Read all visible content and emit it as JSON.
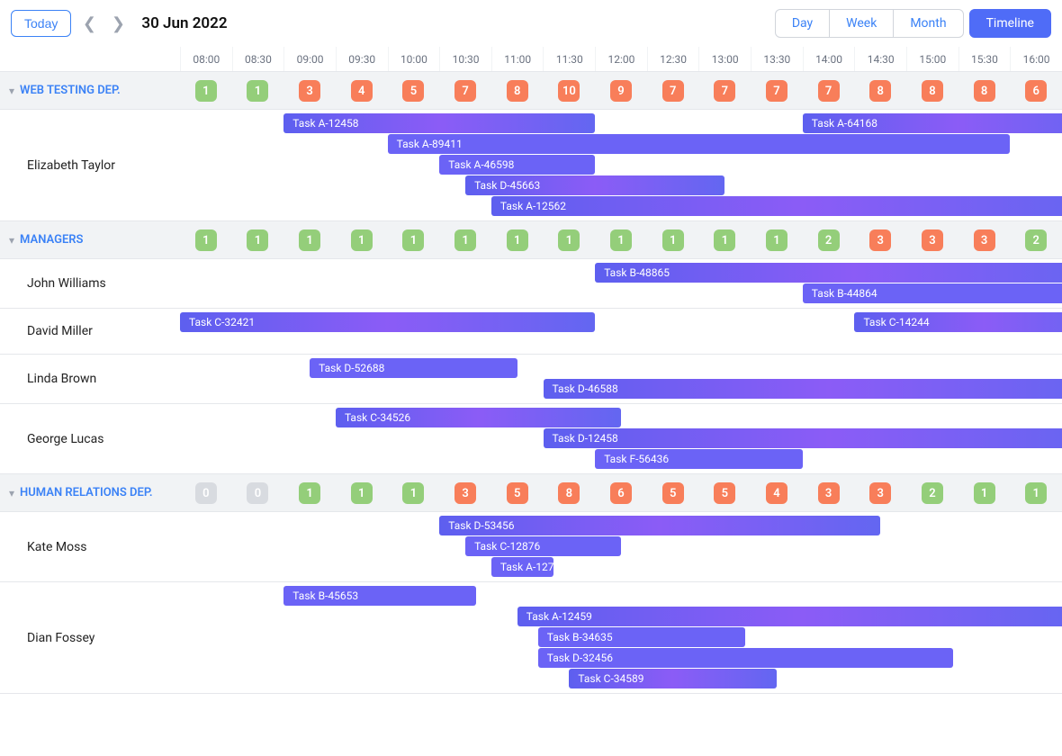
{
  "toolbar": {
    "today": "Today",
    "date": "30 Jun 2022",
    "views": {
      "day": "Day",
      "week": "Week",
      "month": "Month",
      "timeline": "Timeline"
    }
  },
  "timeSlots": [
    "08:00",
    "08:30",
    "09:00",
    "09:30",
    "10:00",
    "10:30",
    "11:00",
    "11:30",
    "12:00",
    "12:30",
    "13:00",
    "13:30",
    "14:00",
    "14:30",
    "15:00",
    "15:30",
    "16:00"
  ],
  "colWidth": 57.65,
  "groups": [
    {
      "name": "WEB TESTING DEP.",
      "badges": [
        {
          "v": "1",
          "c": "green"
        },
        {
          "v": "1",
          "c": "green"
        },
        {
          "v": "3",
          "c": "red"
        },
        {
          "v": "4",
          "c": "red"
        },
        {
          "v": "5",
          "c": "red"
        },
        {
          "v": "7",
          "c": "red"
        },
        {
          "v": "8",
          "c": "red"
        },
        {
          "v": "10",
          "c": "red"
        },
        {
          "v": "9",
          "c": "red"
        },
        {
          "v": "7",
          "c": "red"
        },
        {
          "v": "7",
          "c": "red"
        },
        {
          "v": "7",
          "c": "red"
        },
        {
          "v": "7",
          "c": "red"
        },
        {
          "v": "8",
          "c": "red"
        },
        {
          "v": "8",
          "c": "red"
        },
        {
          "v": "8",
          "c": "red"
        },
        {
          "v": "6",
          "c": "red"
        }
      ],
      "rows": [
        {
          "name": "Elizabeth Taylor",
          "tasks": [
            {
              "label": "Task A-12458",
              "start": 2.0,
              "span": 6.0,
              "row": 0
            },
            {
              "label": "Task A-64168",
              "start": 12.0,
              "span": 6.0,
              "row": 0
            },
            {
              "label": "Task A-89411",
              "start": 4.0,
              "span": 12.0,
              "row": 1,
              "flat": true
            },
            {
              "label": "Task A-46598",
              "start": 5.0,
              "span": 3.0,
              "row": 2,
              "flat": true
            },
            {
              "label": "Task D-45663",
              "start": 5.5,
              "span": 5.0,
              "row": 3
            },
            {
              "label": "Task A-12562",
              "start": 6.0,
              "span": 12.0,
              "row": 4
            }
          ]
        }
      ]
    },
    {
      "name": "MANAGERS",
      "badges": [
        {
          "v": "1",
          "c": "green"
        },
        {
          "v": "1",
          "c": "green"
        },
        {
          "v": "1",
          "c": "green"
        },
        {
          "v": "1",
          "c": "green"
        },
        {
          "v": "1",
          "c": "green"
        },
        {
          "v": "1",
          "c": "green"
        },
        {
          "v": "1",
          "c": "green"
        },
        {
          "v": "1",
          "c": "green"
        },
        {
          "v": "1",
          "c": "green"
        },
        {
          "v": "1",
          "c": "green"
        },
        {
          "v": "1",
          "c": "green"
        },
        {
          "v": "1",
          "c": "green"
        },
        {
          "v": "2",
          "c": "green"
        },
        {
          "v": "3",
          "c": "red"
        },
        {
          "v": "3",
          "c": "red"
        },
        {
          "v": "3",
          "c": "red"
        },
        {
          "v": "2",
          "c": "green"
        }
      ],
      "rows": [
        {
          "name": "John Williams",
          "tasks": [
            {
              "label": "Task B-48865",
              "start": 8.0,
              "span": 10.0,
              "row": 0
            },
            {
              "label": "Task B-44864",
              "start": 12.0,
              "span": 6.0,
              "row": 1,
              "flat": true
            }
          ]
        },
        {
          "name": "David Miller",
          "tasks": [
            {
              "label": "Task C-32421",
              "start": 0.0,
              "span": 8.0,
              "row": 0
            },
            {
              "label": "Task C-14244",
              "start": 13.0,
              "span": 5.0,
              "row": 0
            }
          ]
        },
        {
          "name": "Linda Brown",
          "tasks": [
            {
              "label": "Task D-52688",
              "start": 2.5,
              "span": 4.0,
              "row": 0,
              "flat": true
            },
            {
              "label": "Task D-46588",
              "start": 7.0,
              "span": 11.0,
              "row": 1
            }
          ]
        },
        {
          "name": "George Lucas",
          "tasks": [
            {
              "label": "Task C-34526",
              "start": 3.0,
              "span": 5.5,
              "row": 0
            },
            {
              "label": "Task D-12458",
              "start": 7.0,
              "span": 11.0,
              "row": 1
            },
            {
              "label": "Task F-56436",
              "start": 8.0,
              "span": 4.0,
              "row": 2,
              "flat": true
            }
          ]
        }
      ]
    },
    {
      "name": "HUMAN RELATIONS DEP.",
      "badges": [
        {
          "v": "0",
          "c": "gray"
        },
        {
          "v": "0",
          "c": "gray"
        },
        {
          "v": "1",
          "c": "green"
        },
        {
          "v": "1",
          "c": "green"
        },
        {
          "v": "1",
          "c": "green"
        },
        {
          "v": "3",
          "c": "red"
        },
        {
          "v": "5",
          "c": "red"
        },
        {
          "v": "8",
          "c": "red"
        },
        {
          "v": "6",
          "c": "red"
        },
        {
          "v": "5",
          "c": "red"
        },
        {
          "v": "5",
          "c": "red"
        },
        {
          "v": "4",
          "c": "red"
        },
        {
          "v": "3",
          "c": "red"
        },
        {
          "v": "3",
          "c": "red"
        },
        {
          "v": "2",
          "c": "green"
        },
        {
          "v": "1",
          "c": "green"
        },
        {
          "v": "1",
          "c": "green"
        }
      ],
      "rows": [
        {
          "name": "Kate Moss",
          "tasks": [
            {
              "label": "Task D-53456",
              "start": 5.0,
              "span": 8.5,
              "row": 0
            },
            {
              "label": "Task C-12876",
              "start": 5.5,
              "span": 3.0,
              "row": 1,
              "flat": true
            },
            {
              "label": "Task A-127",
              "start": 6.0,
              "span": 1.2,
              "row": 2,
              "flat": true
            }
          ]
        },
        {
          "name": "Dian Fossey",
          "tasks": [
            {
              "label": "Task B-45653",
              "start": 2.0,
              "span": 3.7,
              "row": 0,
              "flat": true
            },
            {
              "label": "Task A-12459",
              "start": 6.5,
              "span": 11.0,
              "row": 1
            },
            {
              "label": "Task B-34635",
              "start": 6.9,
              "span": 4.0,
              "row": 2,
              "flat": true
            },
            {
              "label": "Task D-32456",
              "start": 6.9,
              "span": 8.0,
              "row": 3,
              "flat": true
            },
            {
              "label": "Task C-34589",
              "start": 7.5,
              "span": 4.0,
              "row": 4
            }
          ]
        }
      ]
    }
  ]
}
